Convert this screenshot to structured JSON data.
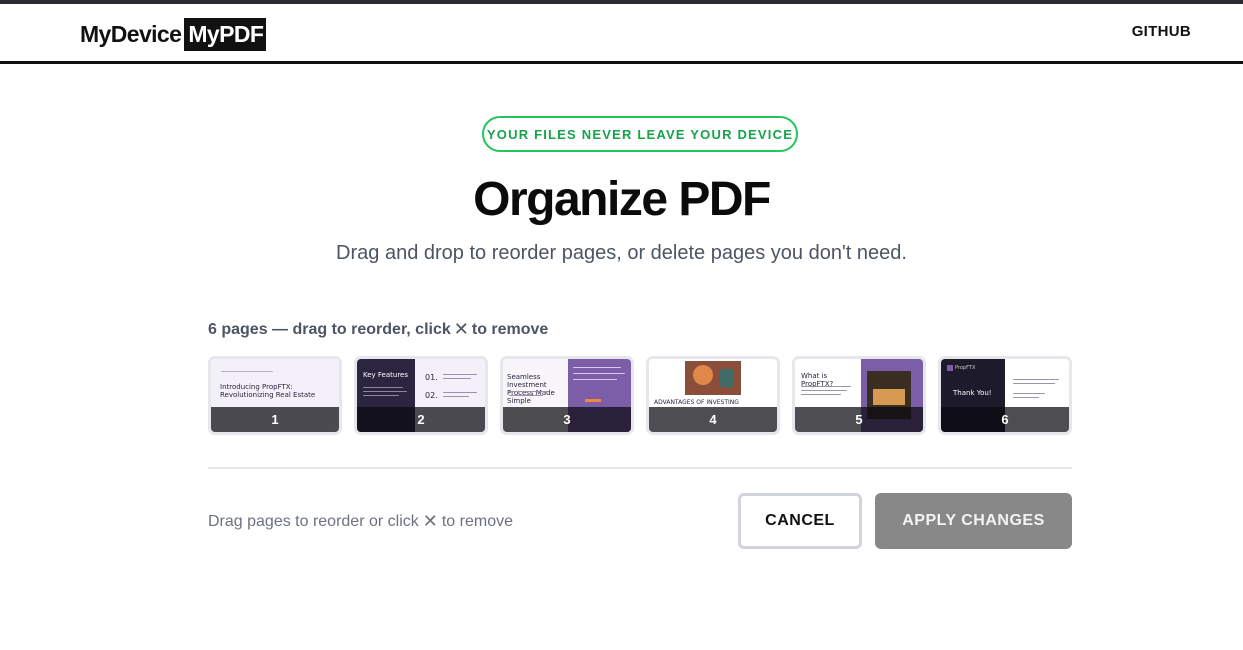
{
  "header": {
    "logo_part1": "MyDevice",
    "logo_part2": "MyPDF",
    "nav_github": "GITHUB"
  },
  "hero": {
    "badge": "YOUR FILES NEVER LEAVE YOUR DEVICE",
    "title": "Organize PDF",
    "subtitle": "Drag and drop to reorder pages, or delete pages you don't need."
  },
  "pages": {
    "label_prefix": "6 pages — drag to reorder, click",
    "label_suffix": "to remove",
    "remove_glyph": "✕",
    "items": [
      {
        "number": "1",
        "heading": "Introducing PropFTX: Revolutionizing Real Estate"
      },
      {
        "number": "2",
        "heading": "Key Features",
        "num_a": "01.",
        "num_b": "02."
      },
      {
        "number": "3",
        "heading": "Seamless Investment Process Made Simple"
      },
      {
        "number": "4",
        "heading": "ADVANTAGES OF INVESTING"
      },
      {
        "number": "5",
        "heading": "What is PropFTX?"
      },
      {
        "number": "6",
        "heading": "Thank You!",
        "brand": "PropFTX"
      }
    ]
  },
  "footer": {
    "hint_prefix": "Drag pages to reorder or click",
    "hint_suffix": "to remove",
    "remove_glyph": "✕",
    "cancel_label": "CANCEL",
    "apply_label": "APPLY CHANGES"
  },
  "colors": {
    "accent_green": "#22c55e",
    "apply_disabled": "#888888",
    "slide_purple": "#7b5ea7"
  }
}
